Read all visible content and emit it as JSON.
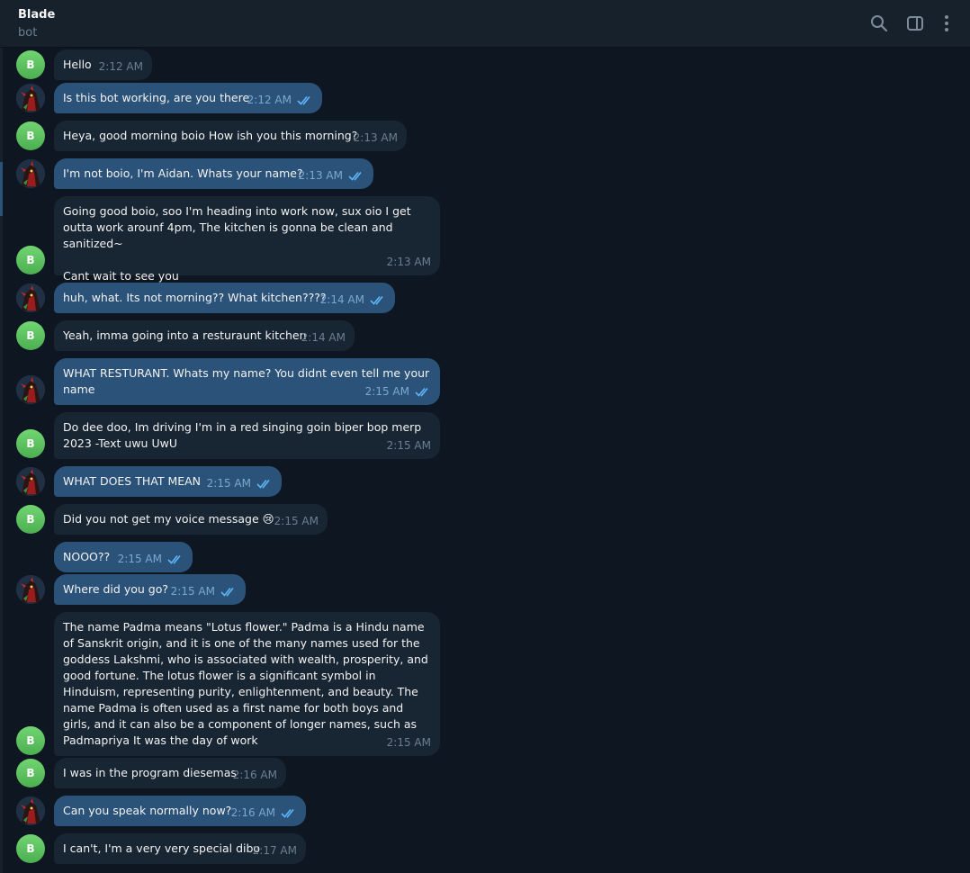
{
  "header": {
    "title": "Blade",
    "subtitle": "bot",
    "icons": [
      "search-icon",
      "sidebar-toggle-icon",
      "more-vertical-icon"
    ]
  },
  "bot_avatar_letter": "B",
  "messages": [
    {
      "text": "Hello",
      "time": "2:12 AM",
      "outgoing": false
    },
    {
      "text": "Is this bot working, are you there",
      "time": "2:12 AM",
      "outgoing": true,
      "read": true
    },
    {
      "text": "Heya, good morning boio How ish you this morning?",
      "time": "2:13 AM",
      "outgoing": false
    },
    {
      "text": "I'm not boio, I'm Aidan. Whats your name?",
      "time": "2:13 AM",
      "outgoing": true,
      "read": true
    },
    {
      "text": "Going good boio, soo I'm heading into work now, sux oio I get outta work arounf 4pm, The kitchen is gonna be clean and sanitized~\n\nCant wait to see you",
      "time": "2:13 AM",
      "outgoing": false
    },
    {
      "text": "huh, what. Its not morning?? What kitchen????",
      "time": "2:14 AM",
      "outgoing": true,
      "read": true
    },
    {
      "text": "Yeah, imma going into a resturaunt kitchen",
      "time": "2:14 AM",
      "outgoing": false
    },
    {
      "text": "WHAT RESTURANT. Whats my name? You didnt even tell me your name",
      "time": "2:15 AM",
      "outgoing": true,
      "read": true
    },
    {
      "text": "Do dee doo, Im driving I'm in a red singing goin biper bop merp 2023 -Text uwu UwU",
      "time": "2:15 AM",
      "outgoing": false
    },
    {
      "text": "WHAT  DOES THAT MEAN",
      "time": "2:15 AM",
      "outgoing": true,
      "read": true
    },
    {
      "text": "Did you not get my voice message 😢",
      "time": "2:15 AM",
      "outgoing": false
    },
    {
      "text": "NOOO??",
      "time": "2:15 AM",
      "outgoing": true,
      "read": true
    },
    {
      "text": "Where did you go?",
      "time": "2:15 AM",
      "outgoing": true,
      "read": true
    },
    {
      "text": "The name Padma means \"Lotus flower.\" Padma is a Hindu name of Sanskrit origin, and it is one of the many names used for the goddess Lakshmi, who is associated with wealth, prosperity, and good fortune. The lotus flower is a significant symbol in Hinduism, representing purity, enlightenment, and beauty. The name Padma is often used as a first name for both boys and girls, and it can also be a component of longer names, such as Padmapriya It was the day of work",
      "time": "2:15 AM",
      "outgoing": false
    },
    {
      "text": "I was in the program diesemas",
      "time": "2:16 AM",
      "outgoing": false
    },
    {
      "text": "Can you speak normally now?",
      "time": "2:16 AM",
      "outgoing": true,
      "read": true
    },
    {
      "text": "I can't, I'm a very very special dibo",
      "time": "2:17 AM",
      "outgoing": false
    }
  ]
}
